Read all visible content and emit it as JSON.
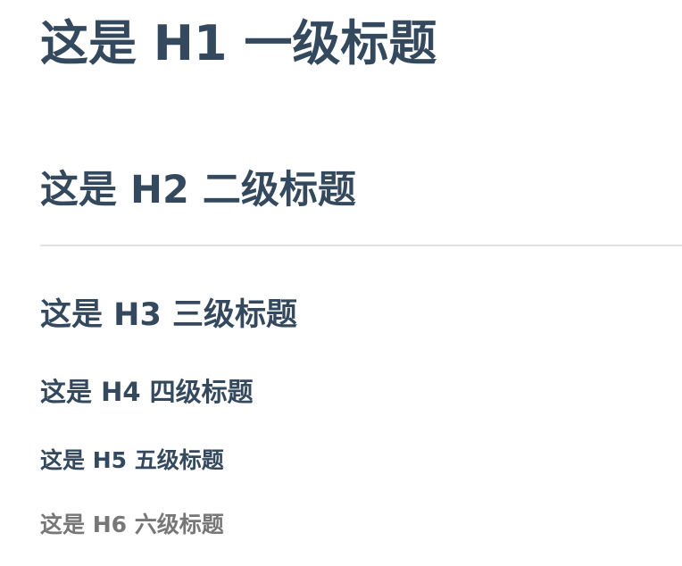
{
  "headings": {
    "h1": "这是 H1 一级标题",
    "h2": "这是 H2 二级标题",
    "h3": "这是 H3 三级标题",
    "h4": "这是 H4 四级标题",
    "h5": "这是 H5 五级标题",
    "h6": "这是 H6 六级标题"
  },
  "colors": {
    "heading": "#34495e",
    "h6": "#777777",
    "divider": "#e2e2e2",
    "background": "#ffffff"
  }
}
